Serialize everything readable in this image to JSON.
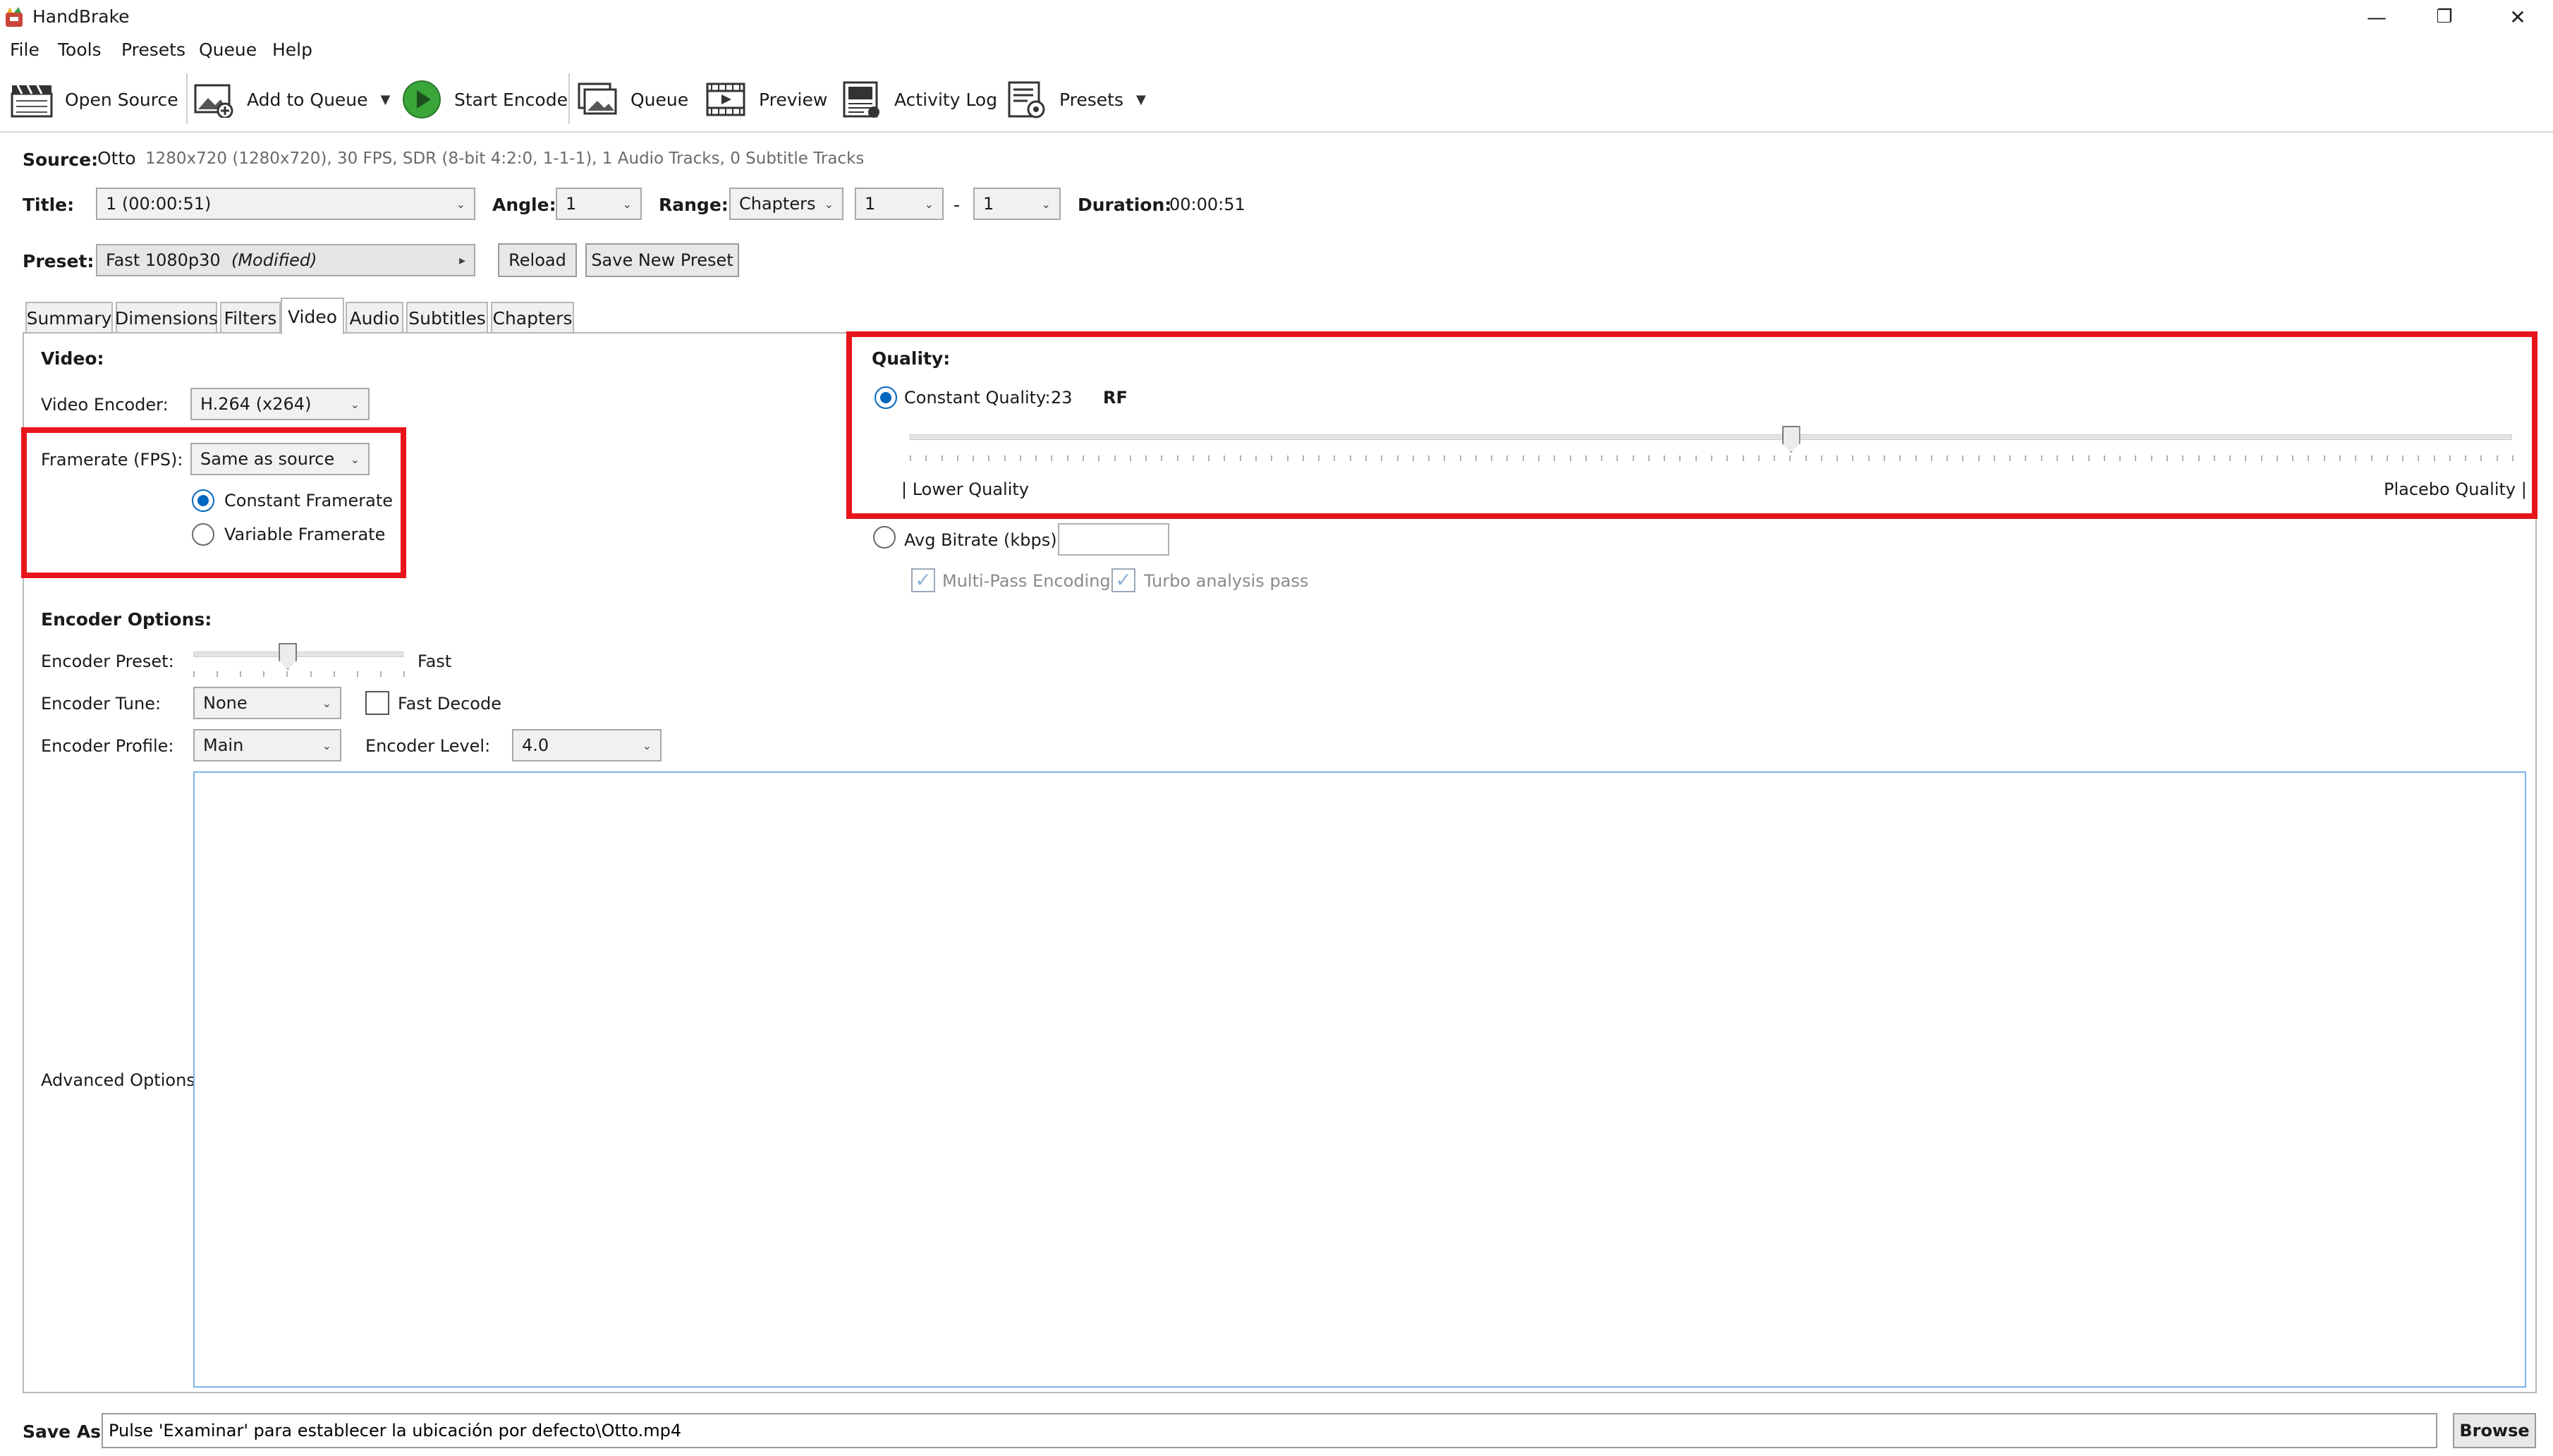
{
  "window": {
    "title": "HandBrake",
    "controls": {
      "minimize": "—",
      "restore": "❐",
      "close": "✕"
    }
  },
  "menu": [
    "File",
    "Tools",
    "Presets",
    "Queue",
    "Help"
  ],
  "toolbar": {
    "open_source": "Open Source",
    "add_to_queue": "Add to Queue",
    "start_encode": "Start Encode",
    "queue": "Queue",
    "preview": "Preview",
    "activity_log": "Activity Log",
    "presets": "Presets",
    "dropdown_caret": "▼"
  },
  "source": {
    "label": "Source:",
    "name": "Otto",
    "info": "1280x720 (1280x720), 30 FPS, SDR (8-bit 4:2:0, 1-1-1), 1 Audio Tracks, 0 Subtitle Tracks"
  },
  "title_row": {
    "title_label": "Title:",
    "title_value": "1  (00:00:51)",
    "angle_label": "Angle:",
    "angle_value": "1",
    "range_label": "Range:",
    "range_type": "Chapters",
    "range_start": "1",
    "range_sep": "-",
    "range_end": "1",
    "duration_label": "Duration:",
    "duration_value": "00:00:51"
  },
  "preset_row": {
    "label": "Preset:",
    "value": "Fast 1080p30",
    "modified": "(Modified)",
    "reload": "Reload",
    "save_new": "Save New Preset"
  },
  "tabs": [
    "Summary",
    "Dimensions",
    "Filters",
    "Video",
    "Audio",
    "Subtitles",
    "Chapters"
  ],
  "active_tab": "Video",
  "video": {
    "heading": "Video:",
    "encoder_label": "Video Encoder:",
    "encoder_value": "H.264 (x264)",
    "framerate_label": "Framerate (FPS):",
    "framerate_value": "Same as source",
    "constant_framerate": "Constant Framerate",
    "variable_framerate": "Variable Framerate",
    "framerate_mode": "constant"
  },
  "quality": {
    "heading": "Quality:",
    "constant_label": "Constant Quality:",
    "constant_value": "23",
    "rf": "RF",
    "slider_fraction": 0.55,
    "lower_label": "| Lower Quality",
    "placebo_label": "Placebo Quality |",
    "avg_bitrate_label": "Avg Bitrate (kbps):",
    "avg_bitrate_value": "",
    "multipass": "Multi-Pass Encoding",
    "turbo": "Turbo analysis pass",
    "check_glyph": "✓"
  },
  "encoder_options": {
    "heading": "Encoder Options:",
    "preset_label": "Encoder Preset:",
    "preset_value": "Fast",
    "preset_fraction": 0.45,
    "tune_label": "Encoder Tune:",
    "tune_value": "None",
    "fast_decode": "Fast Decode",
    "profile_label": "Encoder Profile:",
    "profile_value": "Main",
    "level_label": "Encoder Level:",
    "level_value": "4.0",
    "advanced_label": "Advanced Options:",
    "advanced_value": ""
  },
  "save_as": {
    "label": "Save As:",
    "value": "Pulse 'Examinar' para establecer la ubicación por defecto\\Otto.mp4",
    "browse": "Browse"
  },
  "colors": {
    "accent": "#0067c0",
    "highlight": "#e8141b",
    "play": "#3aa63a"
  },
  "icons": [
    "handbrake-app-icon",
    "clapperboard-icon",
    "add-image-icon",
    "play-icon",
    "queue-images-icon",
    "film-preview-icon",
    "activity-log-icon",
    "presets-settings-icon"
  ]
}
